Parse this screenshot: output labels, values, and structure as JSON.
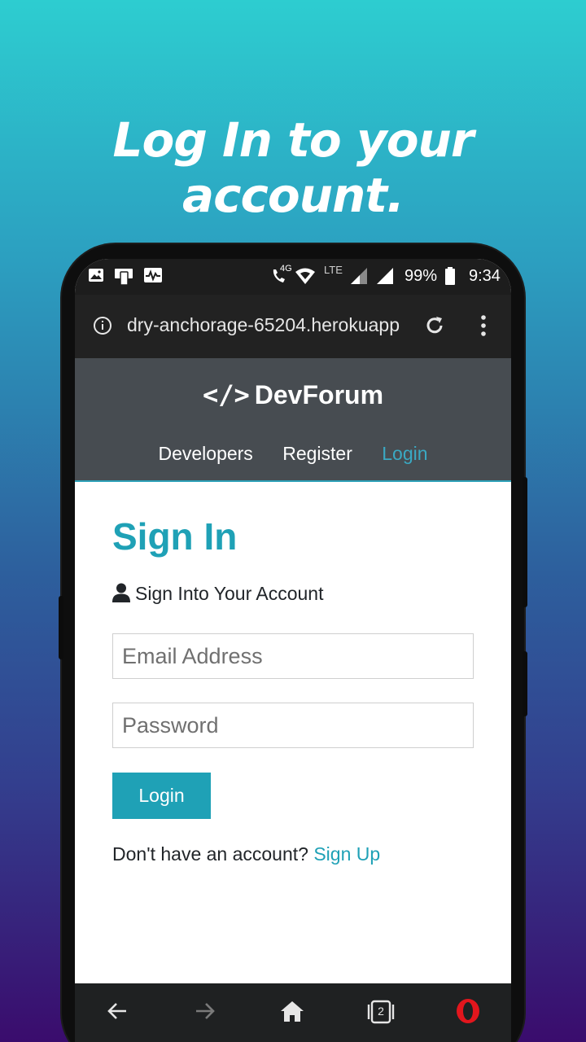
{
  "promo": {
    "headline": "Log In to your account."
  },
  "status_bar": {
    "network": "4G",
    "lte": "LTE",
    "battery": "99%",
    "time": "9:34",
    "icons": [
      "gallery-icon",
      "device-icon",
      "activity-icon",
      "wifi-call-icon",
      "wifi-icon",
      "signal-icon",
      "battery-icon"
    ]
  },
  "browser": {
    "url": "dry-anchorage-65204.herokuapp",
    "tab_count": "2"
  },
  "site": {
    "brand_code": "</>",
    "brand_name": "DevForum",
    "nav": [
      "Developers",
      "Register",
      "Login"
    ],
    "active_nav": "Login"
  },
  "form": {
    "title": "Sign In",
    "lead": "Sign Into Your Account",
    "email_placeholder": "Email Address",
    "password_placeholder": "Password",
    "submit_label": "Login",
    "signup_prompt": "Don't have an account?",
    "signup_link": "Sign Up"
  },
  "colors": {
    "accent": "#1fa1b6",
    "navbar": "#474c51",
    "browser_chrome": "#222222"
  }
}
